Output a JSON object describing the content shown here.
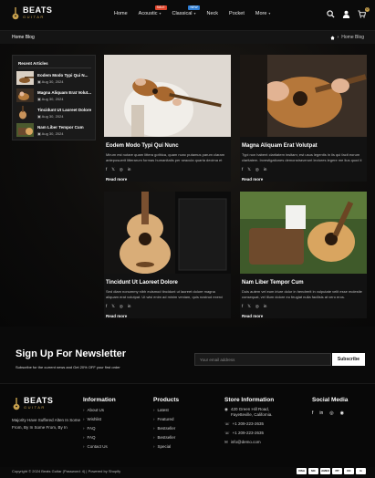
{
  "brand": {
    "name": "BEATS",
    "sub": "GUITAR"
  },
  "nav": [
    {
      "label": "Home",
      "caret": "",
      "badge": ""
    },
    {
      "label": "Acoustic",
      "caret": "▾",
      "badge": "SALE",
      "badge_color": "#e0452c"
    },
    {
      "label": "Classical",
      "caret": "▾",
      "badge": "NEW",
      "badge_color": "#2f7fd6"
    },
    {
      "label": "Neck",
      "caret": "",
      "badge": ""
    },
    {
      "label": "Pocket",
      "caret": "",
      "badge": ""
    },
    {
      "label": "More",
      "caret": "▾",
      "badge": ""
    }
  ],
  "cart_count": "0",
  "breadcrumb": {
    "title": "Home Blog",
    "current": "Home Blog"
  },
  "sidebar": {
    "title": "Recent Articles",
    "items": [
      {
        "name": "Eodem Modo Typi Qui N...",
        "date": "Aug 30, 2024"
      },
      {
        "name": "Magna Aliquam Erat Volut...",
        "date": "Aug 30, 2024"
      },
      {
        "name": "Tincidunt Ut Laoreet Dolore",
        "date": "Aug 30, 2024"
      },
      {
        "name": "Nam Liber Tempor Cum",
        "date": "Aug 30, 2024"
      }
    ]
  },
  "posts": [
    {
      "title": "Eodem Modo Typi Qui Nunc",
      "excerpt": "Mirum est notare quam littera gothica, quam nunc putamus parum claram anteposuerit litterarum formas humanitatis per seacula quarta decima et quinta decima.",
      "read_more": "Read more"
    },
    {
      "title": "Magna Aliquam Erat Volutpat",
      "excerpt": "Typi non habent claritatem insitam; est usus legentis in iis qui facit eorum claritatem. Investigationes demonstraverunt lectores legere me lius quod ii legunt saepius.",
      "read_more": "Read more"
    },
    {
      "title": "Tincidunt Ut Laoreet Dolore",
      "excerpt": "Sed diam nonummy nibh euismod tincidunt ut laoreet dolore magna aliquam erat volutpat. Ut wisi enim ad minim veniam, quis nostrud exerci tation.",
      "read_more": "Read more"
    },
    {
      "title": "Nam Liber Tempor Cum",
      "excerpt": "Duis autem vel eum iriure dolor in hendrerit in vulputate velit esse molestie consequat, vel illum dolore eu feugiat nulla facilisis at vero eros.",
      "read_more": "Read more"
    }
  ],
  "share_icons": [
    "f",
    "𝕏",
    "◎",
    "in"
  ],
  "newsletter": {
    "title": "Sign Up For Newsletter",
    "subtitle": "Subscribe for the current news and Get 20% OFF your first order",
    "placeholder": "Your email address",
    "button": "Subscribe"
  },
  "footer": {
    "about": "Majority Have Suffered Alten In Some From, By In Some From, By In",
    "information": {
      "title": "Information",
      "links": [
        "About Us",
        "Wishlist",
        "FAQ",
        "FAQ",
        "Contact Us"
      ]
    },
    "products": {
      "title": "Products",
      "links": [
        "Latest",
        "Featured",
        "Bestseller",
        "Bestseller",
        "Special"
      ]
    },
    "store": {
      "title": "Store Information",
      "address": "420 Green Hill Road, Fayetteville, California.",
      "phone1": "+1 209-223-2635",
      "phone2": "+1 209-223-2635",
      "email": "info@demo.com"
    },
    "social": {
      "title": "Social Media",
      "icons": [
        "f",
        "in",
        "◎",
        "◉"
      ]
    },
    "copyright": "Copyright © 2024 Beats Guitar (Password: 4) | Powered by Shopify",
    "payments": [
      "VISA",
      "MC",
      "AMEX",
      "PP",
      "DC",
      "G"
    ]
  }
}
